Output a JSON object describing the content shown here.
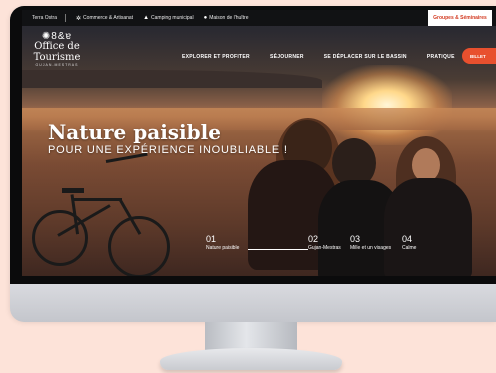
{
  "topbar": {
    "items": [
      {
        "label": "Terra Ostra",
        "icon": ""
      },
      {
        "label": "Commerce & Artisanat",
        "icon": "shop-icon"
      },
      {
        "label": "Camping municipal",
        "icon": "tent-icon"
      },
      {
        "label": "Maison de l'huître",
        "icon": "pin-icon"
      }
    ],
    "groupes_label": "Groupes & Séminaires"
  },
  "logo": {
    "line1": "Office de",
    "line2": "Tourisme",
    "line3": "GUJAN-MESTRAS"
  },
  "nav": {
    "items": [
      "EXPLORER ET PROFITER",
      "SÉJOURNER",
      "SE DÉPLACER SUR LE BASSIN",
      "PRATIQUE"
    ],
    "cta_label": "BILLET"
  },
  "hero": {
    "title": "Nature paisible",
    "subtitle": "POUR UNE EXPÉRIENCE INOUBLIABLE !"
  },
  "slides": [
    {
      "num": "01",
      "label": "Nature paisible"
    },
    {
      "num": "02",
      "label": "Gujan-Mestras"
    },
    {
      "num": "03",
      "label": "Mille et un visages"
    },
    {
      "num": "04",
      "label": "Calme"
    }
  ],
  "colors": {
    "accent": "#e8502e",
    "groupes_text": "#d23a21",
    "background": "#fde3d9"
  }
}
